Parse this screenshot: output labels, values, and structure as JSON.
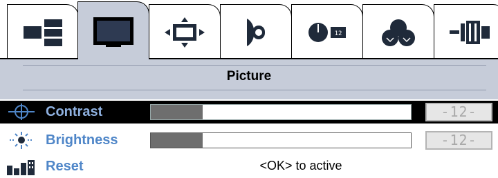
{
  "menu": {
    "tabs": [
      {
        "icon": "input-source-icon",
        "active": false
      },
      {
        "icon": "monitor-picture-icon",
        "active": true
      },
      {
        "icon": "image-position-icon",
        "active": false
      },
      {
        "icon": "audio-speaker-icon",
        "active": false
      },
      {
        "icon": "osd-timer-icon",
        "active": false
      },
      {
        "icon": "color-settings-icon",
        "active": false
      },
      {
        "icon": "power-connector-icon",
        "active": false
      }
    ],
    "title": "Picture"
  },
  "items": {
    "contrast": {
      "label": "Contrast",
      "value": "-12-",
      "level": 0.2,
      "selected": true,
      "icon": "contrast-icon"
    },
    "brightness": {
      "label": "Brightness",
      "value": "-12-",
      "level": 0.2,
      "selected": false,
      "icon": "brightness-icon"
    },
    "reset": {
      "label": "Reset",
      "info": "<OK> to active",
      "icon": "reset-icon"
    }
  },
  "colors": {
    "panel": "#c6ccd9",
    "label": "#4f86c8",
    "selected_row": "#000000",
    "bar_fill": "#6e6e6e"
  }
}
